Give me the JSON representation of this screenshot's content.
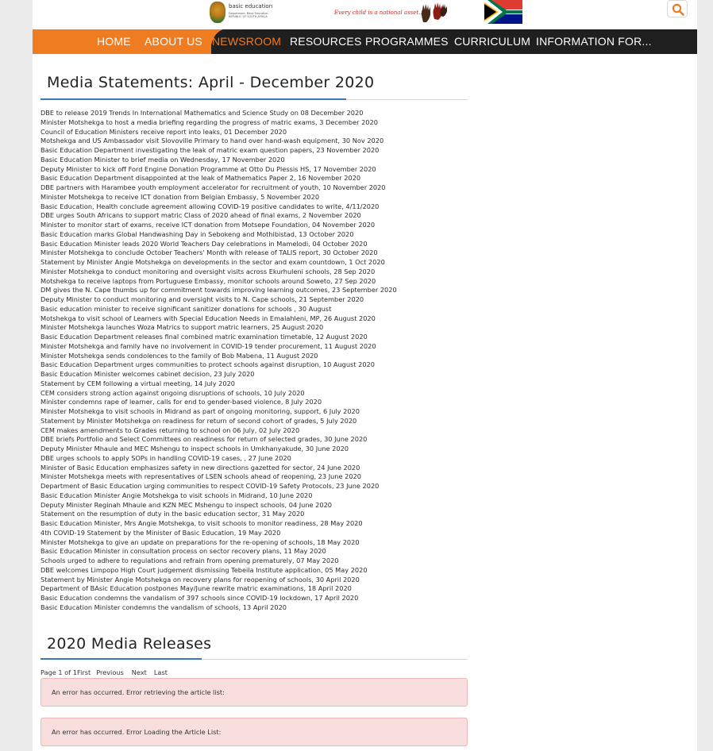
{
  "header": {
    "logo_title": "basic education",
    "logo_sub": "Department: Basic Education REPUBLIC OF SOUTH AFRICA",
    "tagline": "Every child is a national asset...",
    "search_icon": "search-icon"
  },
  "nav": {
    "items": [
      {
        "label": "HOME"
      },
      {
        "label": "ABOUT US"
      },
      {
        "label": "NEWSROOM"
      },
      {
        "label": "RESOURCES"
      },
      {
        "label": "PROGRAMMES"
      },
      {
        "label": "CURRICULUM"
      },
      {
        "label": "INFORMATION FOR..."
      }
    ],
    "active": "NEWSROOM",
    "accent": "#f07c22",
    "bar": "#1f1f1f"
  },
  "main": {
    "heading": "Media Statements: April - December 2020",
    "statements": [
      "DBE to release 2019 Trends In International Mathematics and Science Study on 08 December 2020",
      "Minister Motshekga to host a media briefing regarding the progress of matric exams, 3 December 2020",
      "Council of Education Ministers receive report into leaks, 01 December 2020",
      "Motshekga and US Ambassador visit Slovoville Primary to hand over hand-wash equipment, 30 Nov 2020",
      "Basic Education Department investigating the leak of matric exam question papers, 23 November 2020",
      "Basic Education Minister to brief media on Wednesday, 17 November 2020",
      "Deputy Minister to kick off Ford Engine Donation Programme at Otto Du Plessis HS, 17 November 2020",
      "Basic Education Department disappointed at the leak of Mathematics Paper 2, 16 November 2020",
      "DBE partners with Harambee youth employment accelerator for recruitment of youth, 10 November 2020",
      "Minister Motshekga to receive ICT donation from Belgian Embassy, 5 November 2020",
      "Basic Education, Health conclude agreement allowing COVID-19 positive candidates to write, 4/11/2020",
      "DBE urges South Africans to support matric Class of 2020 ahead of final exams, 2 November 2020",
      "Minister to monitor start of exams, receive ICT donation from Motsepe Foundation, 04 November 2020",
      "Basic Education marks Global Handwashing Day in Sebokeng and Mothibistad, 13 October 2020",
      "Basic Education Minister leads 2020 World Teachers Day celebrations in Mamelodi, 04 October 2020",
      "Minister Motshekga to conclude October Teachers' Month with release of TALIS report, 30 October 2020",
      "Statement by Minister Angie Motshekga on developments in the sector and exam countdown, 1 Oct 2020",
      "Minister Motshekga to conduct monitoring and oversight visits across Ekurhuleni schools, 28 Sep 2020",
      "Motshekga to receive laptops from Portuguese Embassy, monitor schools around Soweto, 27 Sep 2020",
      "DM gives the N. Cape thumbs up for commitment towards improving learning outcomes, 23 September 2020",
      "Deputy Minister to conduct monitoring and oversight visits to N. Cape schools, 21 September 2020",
      "Basic education minister to receive significant sanitizer donations for schools , 30 August",
      "Motshekga to visit school of Learners with Special Education Needs in Emalahleni, MP, 26 August 2020",
      "Minister Motshekga launches Woza Matrics to support matric learners, 25 August 2020",
      "Basic Education Department releases final combined matric examination timetable, 12 August 2020",
      "Minister Motshekga and family have no involvement in COVID-19 tender procurement, 11 August 2020",
      "Minister Motshekga sends condolences to the family of Bob Mabena, 11 August 2020",
      "Basic Education Department urges communities to protect schools against disruption, 10 August 2020",
      "Basic Education Minister welcomes cabinet decision, 23 July 2020",
      "Statement by CEM following a virtual meeting, 14 July 2020",
      "CEM considers strong action against ongoing disruptions of schools, 10 July 2020",
      "Minister condemns rape of learner, calls for end to gender-based violence, 8 July 2020",
      "Minister Motshekga to visit schools in Midrand as part of ongoing monitoring, support, 6 July 2020",
      "Statement by Minister Motshekga on readiness for return of second cohort of grades, 5 July 2020",
      "CEM makes amendments to Grades returning to school on 06 July, 02 July 2020",
      "DBE briefs Portfolio and Select Committees on readiness for return of selected grades, 30 June 2020",
      "Deputy Minister Mhaule and MEC Mshengu to inspect schools in Umkhanyakude, 30 June 2020",
      "DBE urges schools to apply SOPs in handling COVID-19 cases, , 27 June 2020",
      "Minister of Basic Education emphasizes safety in new directions gazetted for sector, 24 June 2020",
      "Minister Motshekga meets with representatives of LSEN schools ahead of reopening, 23 June 2020",
      "Department of Basic Education urging communities to respect COVID-19 Safety Protocols, 23 June 2020",
      "Basic Education Minister Angie Motshekga to visit schools in Midrand, 10 June 2020",
      "Deputy Minister Reginah Mhaule and KZN MEC Mshengu to inspect schools, 04 June 2020",
      "Statement on the resumption of duty in the basic education sector, 31 May 2020",
      "Basic Education Minister, Mrs Angie Motshekga, to visit schools to monitor readiness, 28 May 2020",
      "4th COVID-19 Statement by the Minister of Basic Education, 19 May 2020",
      "Minister Motshekga to give an update on preparations for the re-opening of schools, 18 May 2020",
      "Basic Education Minister in consultation process on sector recovery plans, 11 May 2020",
      "Schools urged to adhere to regulations and refrain from opening prematurely, 07 May 2020",
      "DBE welcomes Limpopo High Court judgement dismissing Tebeila Institute application, 05 May 2020",
      "Statement by Minister Angie Motshekga on recovery plans for reopening of schools, 30 April 2020",
      "Department of BAsic Education postpones May/June rewrite matric examinations, 18 April 2020",
      "Basic Education condemns the vandalism of 397 schools since COVID-19 lockdown, 17 April 2020",
      "Basic Education Minister condemns the vandalism of schools, 13 April 2020"
    ],
    "releases_heading": "2020 Media Releases",
    "pager": {
      "page_text": "Page 1 of 1",
      "first": "First",
      "previous": "Previous",
      "next": "Next",
      "last": "Last"
    },
    "errors": [
      "An error has occurred. Error retrieving the article list:",
      "An error has occurred. Error Loading the Article List:"
    ]
  }
}
